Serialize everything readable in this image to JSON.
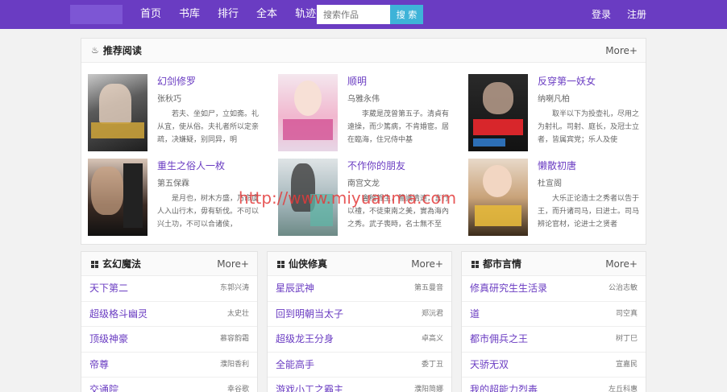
{
  "header": {
    "nav": [
      "首页",
      "书库",
      "排行",
      "全本",
      "轨迹"
    ],
    "search_placeholder": "搜索作品",
    "search_button": "搜 索",
    "login": "登录",
    "register": "注册"
  },
  "recommend": {
    "title": "推荐阅读",
    "more": "More+",
    "books": [
      {
        "title": "幻剑修罗",
        "author": "张秋巧",
        "desc": "若夫、坐如尸，立如斋。礼从宜，使从俗。夫礼者所以定亲疏，决嫌疑，别同异，明"
      },
      {
        "title": "顺明",
        "author": "乌雅永伟",
        "desc": "李葳是茂曾第五子。清貞有遠操，而少篤病，不肯婚宦。居在臨海，住兄侍中基"
      },
      {
        "title": "反穿第一妖女",
        "author": "纳喇凡柏",
        "desc": "取半以下为投壶礼，尽用之为射礼。司射、庭长，及冠士立者，皆属宾党；乐人及使"
      },
      {
        "title": "重生之俗人一枚",
        "author": "第五保霖",
        "desc": "是月也，树木方盛，乃命虞人入山行木，毋有斩伐。不可以兴土功，不可以合诸侯，"
      },
      {
        "title": "不作你的朋友",
        "author": "南宫文龙",
        "desc": "會稽賀生，體識清遠，言行以禮，不徒東南之美，實為海內之秀。武子喪時，名士無不至者。子荊後"
      },
      {
        "title": "懒散初唐",
        "author": "杜宣阁",
        "desc": "大乐正论造士之秀者以告于王，而升诸司马，曰进士。司马辨论官材，论进士之贤者"
      }
    ]
  },
  "sections": [
    {
      "title": "玄幻魔法",
      "more": "More+",
      "items": [
        {
          "title": "天下第二",
          "author": "东郭兴涛"
        },
        {
          "title": "超级格斗幽灵",
          "author": "太史壮"
        },
        {
          "title": "顶级神豪",
          "author": "慕容韵霜"
        },
        {
          "title": "帝尊",
          "author": "濮阳香利"
        },
        {
          "title": "交通院",
          "author": "幸谷歌"
        }
      ]
    },
    {
      "title": "仙侠修真",
      "more": "More+",
      "items": [
        {
          "title": "星辰武神",
          "author": "第五曼音"
        },
        {
          "title": "回到明朝当太子",
          "author": "郑沅君"
        },
        {
          "title": "超级龙王分身",
          "author": "卓高义"
        },
        {
          "title": "全能高手",
          "author": "委丁丑"
        },
        {
          "title": "游戏小工之霸主",
          "author": "濮阳简娜"
        }
      ]
    },
    {
      "title": "都市言情",
      "more": "More+",
      "items": [
        {
          "title": "修真研究生生活录",
          "author": "公治志敏"
        },
        {
          "title": "道",
          "author": "司空真"
        },
        {
          "title": "都市佣兵之王",
          "author": "树丁巳"
        },
        {
          "title": "天骄无双",
          "author": "宣嘉民"
        },
        {
          "title": "我的超能力烈毒",
          "author": "左丘科惠"
        }
      ]
    }
  ],
  "watermark": "http://www.miyuanma.com",
  "colors": {
    "brand": "#6a3cc2",
    "search_btn": "#3eb3d8"
  }
}
